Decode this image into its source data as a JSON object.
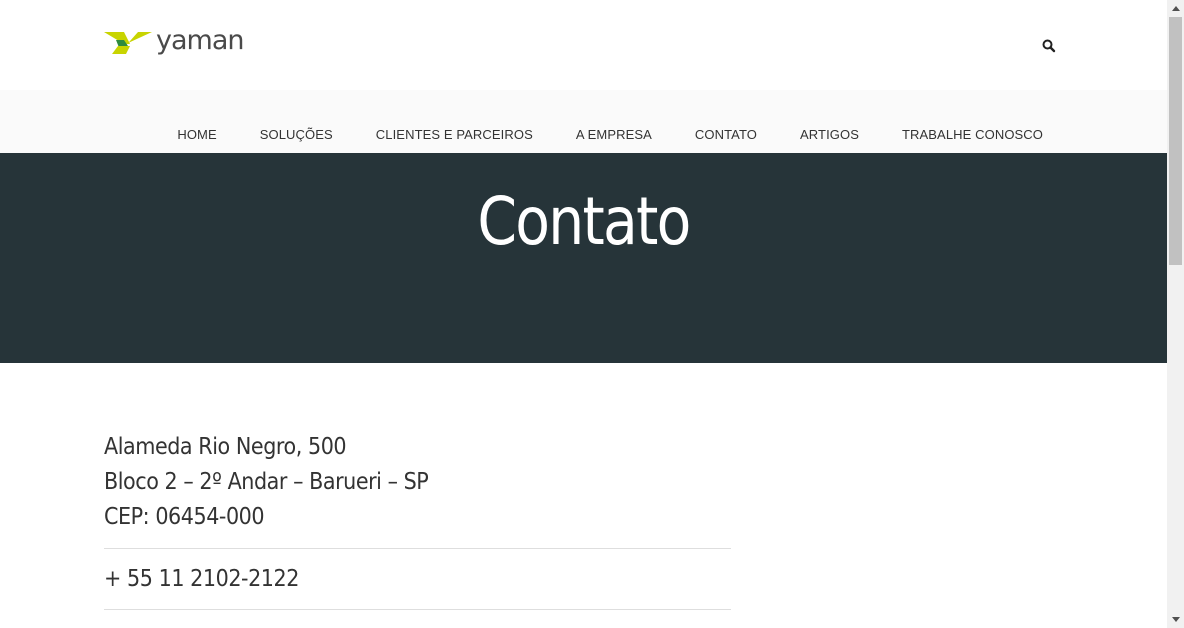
{
  "header": {
    "logo_text": "yaman",
    "logo_colors": {
      "lime": "#c8d400",
      "green": "#2e8b3e"
    },
    "search_icon": "search-icon"
  },
  "nav": {
    "items": [
      {
        "label": "HOME"
      },
      {
        "label": "SOLUÇÕES"
      },
      {
        "label": "CLIENTES E PARCEIROS"
      },
      {
        "label": "A EMPRESA"
      },
      {
        "label": "CONTATO"
      },
      {
        "label": "ARTIGOS"
      },
      {
        "label": "TRABALHE CONOSCO"
      }
    ]
  },
  "hero": {
    "title": "Contato",
    "background": "#263439"
  },
  "contact": {
    "address_lines": [
      "Alameda Rio Negro, 500",
      "Bloco 2 – 2º Andar – Barueri – SP",
      "CEP: 06454-000"
    ],
    "phone": "+ 55 11 2102-2122"
  }
}
